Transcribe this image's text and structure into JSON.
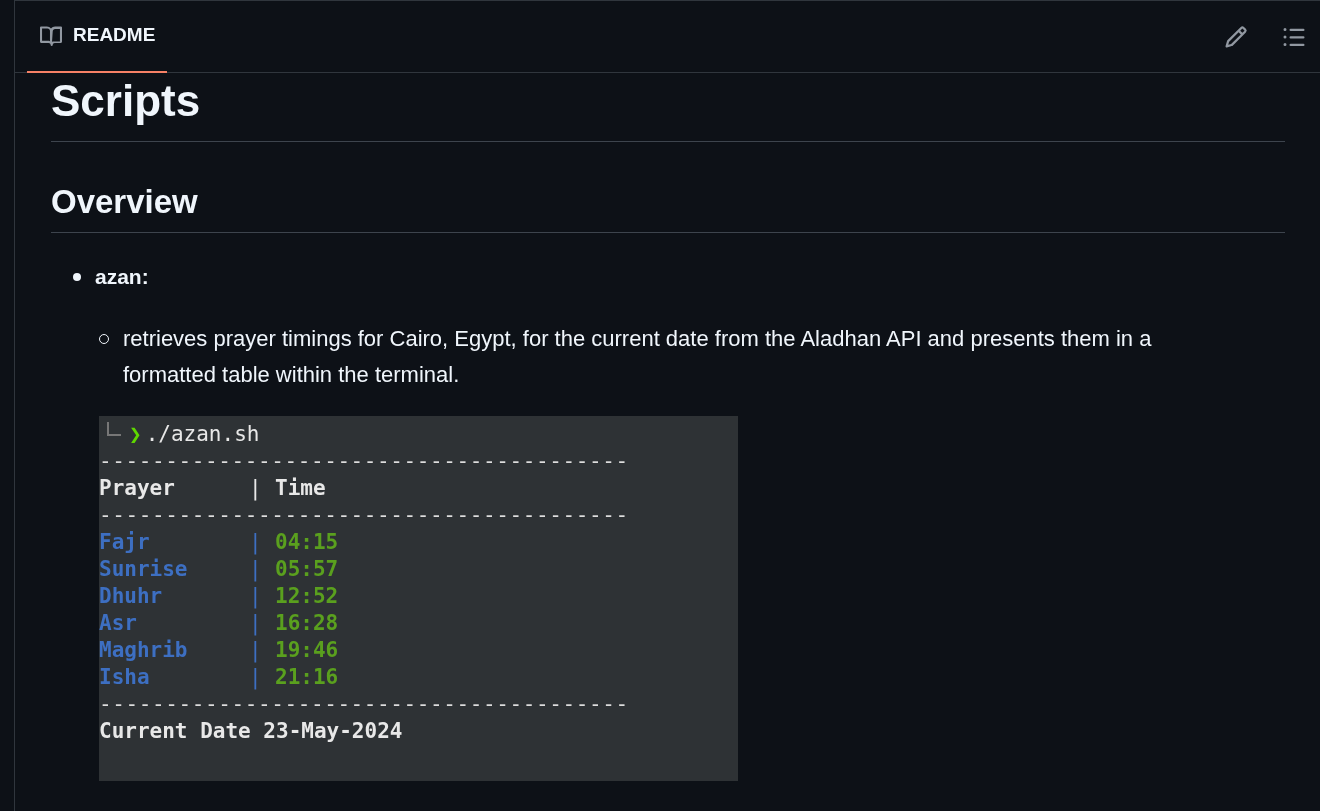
{
  "tab": {
    "label": "README",
    "selected": true
  },
  "title": "Scripts",
  "section": "Overview",
  "list": [
    {
      "label": "azan:",
      "items": [
        "retrieves prayer timings for Cairo, Egypt, for the current date from the Aladhan API and presents them in a formatted table within the terminal."
      ]
    }
  ],
  "terminal": {
    "lines": [
      {
        "kind": "prompt",
        "symbol": "❯",
        "text": "./azan.sh"
      },
      {
        "kind": "separator",
        "text": "----------------------------------------"
      },
      {
        "kind": "header",
        "name": "Prayer",
        "divider": "|",
        "value": "Time"
      },
      {
        "kind": "separator",
        "text": "----------------------------------------"
      },
      {
        "kind": "row",
        "name": "Fajr",
        "divider": "|",
        "value": "04:15"
      },
      {
        "kind": "row",
        "name": "Sunrise",
        "divider": "|",
        "value": "05:57"
      },
      {
        "kind": "row",
        "name": "Dhuhr",
        "divider": "|",
        "value": "12:52"
      },
      {
        "kind": "row",
        "name": "Asr",
        "divider": "|",
        "value": "16:28"
      },
      {
        "kind": "row",
        "name": "Maghrib",
        "divider": "|",
        "value": "19:46"
      },
      {
        "kind": "row",
        "name": "Isha",
        "divider": "|",
        "value": "21:16"
      },
      {
        "kind": "separator",
        "text": "----------------------------------------"
      },
      {
        "kind": "text",
        "text": "Current Date 23-May-2024"
      }
    ]
  }
}
